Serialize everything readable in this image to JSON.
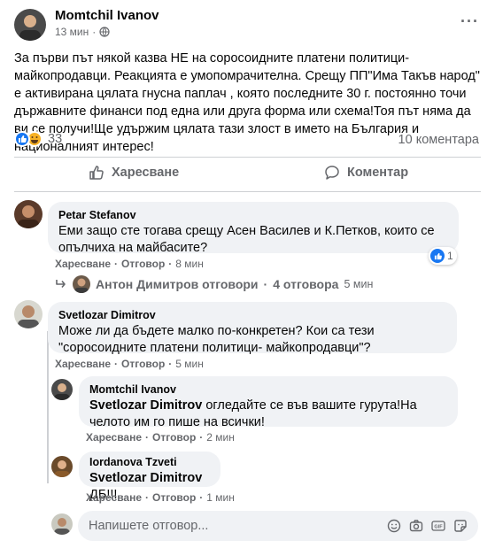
{
  "post": {
    "author": "Momtchil Ivanov",
    "time": "13 мин",
    "text": "За първи път някой казва НЕ на соросоидните платени политици- майкопродавци. Реакцията е умопомрачителна. Срещу ПП\"Има Такъв народ\" е активирана цялата гнусна паплач , която последните 30 г. постоянно точи държавните финанси под една или друга форма или схема!Тоя път няма да ви се получи!Ще удържим цялата тази злост в името на България и националният интерес!",
    "reactions_count": "33",
    "comments_count": "10 коментара",
    "like_label": "Харесване",
    "comment_label": "Коментар"
  },
  "comments": [
    {
      "name": "Petar Stefanov",
      "text": "Еми защо сте тогава срещу Асен Василев и К.Петков, които се опълчиха на майбасите?",
      "like": "Харесване",
      "reply": "Отговор",
      "time": "8 мин",
      "reactions": "1",
      "replies_author": "Антон Димитров отговори",
      "replies_count": "4 отговора",
      "replies_time": "5 мин"
    },
    {
      "name": "Svetlozar Dimitrov",
      "text": "Може ли да бъдете малко по-конкретен? Кои са тези \"соросоидните платени политици- майкопродавци\"?",
      "like": "Харесване",
      "reply": "Отговор",
      "time": "5 мин",
      "replies": [
        {
          "name": "Momtchil Ivanov",
          "mention": "Svetlozar Dimitrov",
          "text": " огледайте се във вашите гурута!На челото им го пише на всички!",
          "like": "Харесване",
          "reply": "Отговор",
          "time": "2 мин"
        },
        {
          "name": "Iordanova Tzveti",
          "mention": "Svetlozar Dimitrov",
          "text": " ДБ!!!",
          "like": "Харесване",
          "reply": "Отговор",
          "time": "1 мин"
        }
      ]
    }
  ],
  "reply_input": {
    "placeholder": "Напишете отговор..."
  },
  "separator": "·",
  "icons": [
    "globe-icon",
    "more-icon",
    "like-icon",
    "haha-icon",
    "thumbs-up-icon",
    "comment-icon",
    "replies-arrow-icon",
    "emoji-icon",
    "camera-icon",
    "gif-icon",
    "sticker-icon"
  ],
  "colors": {
    "like_blue": "#1877f2",
    "haha_yellow": "#f7b125",
    "bubble": "#f0f2f5",
    "secondary_text": "#65676b"
  }
}
